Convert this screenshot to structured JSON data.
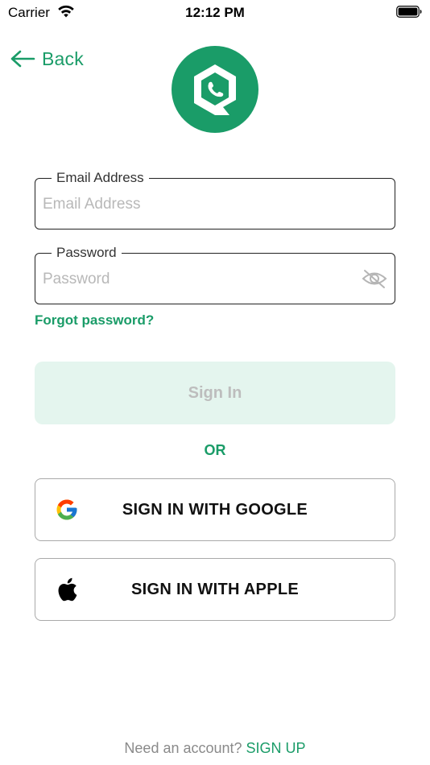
{
  "status_bar": {
    "carrier": "Carrier",
    "time": "12:12 PM",
    "icons": [
      "wifi-icon",
      "battery-icon"
    ]
  },
  "header": {
    "back_label": "Back",
    "back_icon": "arrow-left-icon",
    "logo_icon": "phone-hexagon-logo"
  },
  "form": {
    "email": {
      "label": "Email Address",
      "placeholder": "Email Address",
      "value": ""
    },
    "password": {
      "label": "Password",
      "placeholder": "Password",
      "value": "",
      "visibility_icon": "eye-off-icon"
    },
    "forgot_password": "Forgot password?",
    "sign_in_label": "Sign In",
    "sign_in_enabled": false
  },
  "divider_text": "OR",
  "social": {
    "google_label": "SIGN IN WITH GOOGLE",
    "google_icon": "google-icon",
    "apple_label": "SIGN IN WITH APPLE",
    "apple_icon": "apple-icon"
  },
  "footer": {
    "prompt": "Need an account?",
    "link": "SIGN UP"
  },
  "colors": {
    "brand_green": "#1a9c68",
    "disabled_button_bg": "#e4f5ee",
    "disabled_button_text": "#bdbdbd",
    "placeholder": "#b8b8b8"
  }
}
